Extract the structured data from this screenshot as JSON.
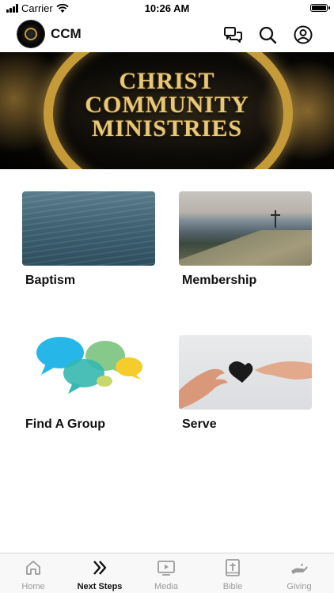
{
  "status_bar": {
    "carrier": "Carrier",
    "time": "10:26 AM"
  },
  "header": {
    "title": "CCM",
    "icons": [
      "chat-icon",
      "search-icon",
      "profile-icon"
    ]
  },
  "banner": {
    "lines": [
      "CHRIST",
      "COMMUNITY",
      "MINISTRIES"
    ]
  },
  "tiles": [
    {
      "label": "Baptism",
      "image": "ocean-water"
    },
    {
      "label": "Membership",
      "image": "mountain-cross"
    },
    {
      "label": "Find A Group",
      "image": "speech-bubbles"
    },
    {
      "label": "Serve",
      "image": "hands-heart"
    }
  ],
  "tab_bar": {
    "tabs": [
      {
        "label": "Home",
        "icon": "home-icon"
      },
      {
        "label": "Next Steps",
        "icon": "next-steps-icon",
        "active": true
      },
      {
        "label": "Media",
        "icon": "media-icon"
      },
      {
        "label": "Bible",
        "icon": "bible-icon"
      },
      {
        "label": "Giving",
        "icon": "giving-icon"
      }
    ]
  },
  "colors": {
    "banner_gold": "#e7c77a",
    "tab_inactive": "#9a9a9a",
    "tab_active": "#111111"
  }
}
